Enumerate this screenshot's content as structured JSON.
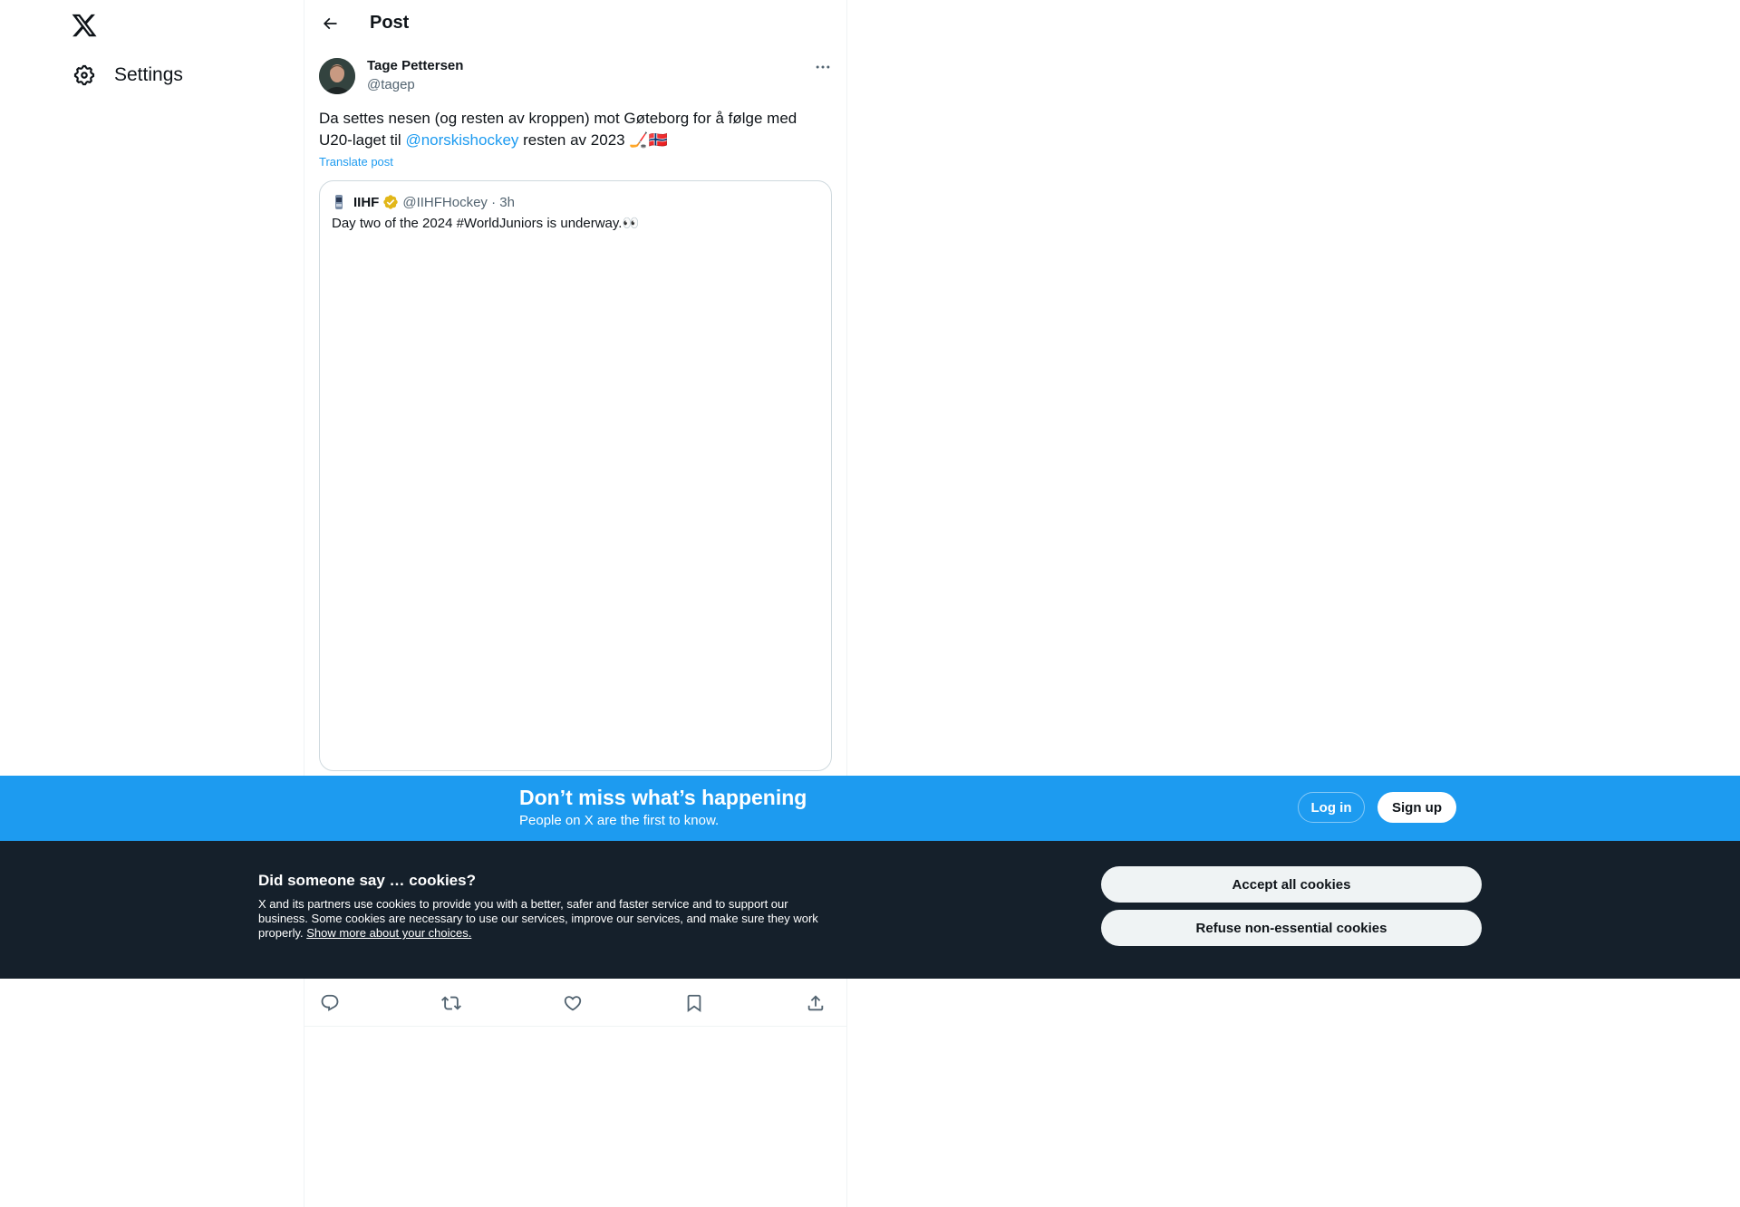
{
  "nav": {
    "settings_label": "Settings",
    "logo_icon": "x-logo-icon",
    "settings_icon": "gear-icon"
  },
  "header": {
    "title": "Post",
    "back_icon": "arrow-left-icon"
  },
  "post": {
    "author_name": "Tage Pettersen",
    "author_handle": "@tagep",
    "text_before": "Da settes nesen (og resten av kroppen) mot Gøteborg for å følge med U20-laget til ",
    "mention": "@norskishockey",
    "text_after": " resten av 2023 🏒🇳🇴",
    "translate_label": "Translate post"
  },
  "quote": {
    "name": "IIHF",
    "handle_time": "@IIHFHockey · 3h",
    "text": "Day two of the 2024 #WorldJuniors is underway.👀"
  },
  "actions": [
    "reply-icon",
    "repost-icon",
    "like-icon",
    "bookmark-icon",
    "share-icon"
  ],
  "banner": {
    "title": "Don’t miss what’s happening",
    "subtitle": "People on X are the first to know.",
    "login_label": "Log in",
    "signup_label": "Sign up",
    "color": "#1d9bf0"
  },
  "cookies": {
    "title": "Did someone say … cookies?",
    "text": "X and its partners use cookies to provide you with a better, safer and faster service and to support our business. Some cookies are necessary to use our services, improve our services, and make sure they work properly. ",
    "link": "Show more about your choices.",
    "accept_label": "Accept all cookies",
    "refuse_label": "Refuse non-essential cookies",
    "background": "#15202b"
  }
}
